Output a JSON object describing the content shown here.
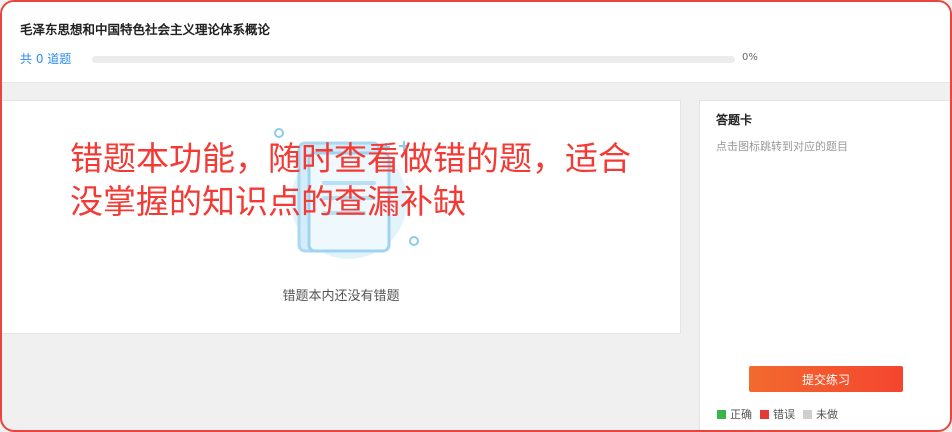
{
  "header": {
    "course_title": "毛泽东思想和中国特色社会主义理论体系概论",
    "question_count": "共 0 道题",
    "progress_label": "0%",
    "progress_value": 0
  },
  "main": {
    "empty_message": "错题本内还没有错题"
  },
  "overlay": {
    "caption_line1": "错题本功能，随时查看做错的题，适合",
    "caption_line2": "没掌握的知识点的查漏补缺"
  },
  "answer_card": {
    "title": "答题卡",
    "hint": "点击图标跳转到对应的题目",
    "submit_label": "提交练习",
    "legend": [
      {
        "label": "正确",
        "color": "#3ab54a"
      },
      {
        "label": "错误",
        "color": "#e63b35"
      },
      {
        "label": "未做",
        "color": "#cfcfcf"
      }
    ]
  },
  "colors": {
    "accent_blue": "#2d8cf0",
    "frame_red": "#e8453c",
    "button_orange": "#f4452f"
  }
}
